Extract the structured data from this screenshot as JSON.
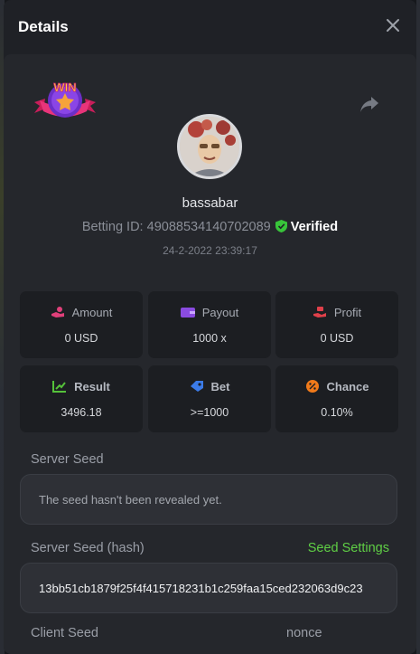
{
  "header": {
    "title": "Details"
  },
  "player": {
    "badge_text": "WIN",
    "username": "bassabar",
    "betting_id_label": "Betting ID:",
    "betting_id": "49088534140702089",
    "verified_label": "Verified",
    "datetime": "24-2-2022 23:39:17"
  },
  "stats": [
    {
      "label": "Amount",
      "value": "0 USD",
      "icon": "hand-coin-icon",
      "color": "#e0407a"
    },
    {
      "label": "Payout",
      "value": "1000 x",
      "icon": "wallet-icon",
      "color": "#8a4be0"
    },
    {
      "label": "Profit",
      "value": "0 USD",
      "icon": "hand-money-icon",
      "color": "#e0404a"
    },
    {
      "label": "Result",
      "value": "3496.18",
      "icon": "chart-check-icon",
      "color": "#55c23a"
    },
    {
      "label": "Bet",
      "value": ">=1000",
      "icon": "tag-icon",
      "color": "#3b7be8"
    },
    {
      "label": "Chance",
      "value": "0.10%",
      "icon": "percent-icon",
      "color": "#f07a1a"
    }
  ],
  "seeds": {
    "server_seed_label": "Server Seed",
    "server_seed_value": "The seed hasn't been revealed yet.",
    "server_hash_label": "Server Seed (hash)",
    "seed_settings_label": "Seed Settings",
    "server_hash_value": "13bb51cb1879f25f4f415718231b1c259faa15ced232063d9c23",
    "client_seed_label": "Client Seed",
    "nonce_label": "nonce"
  },
  "colors": {
    "accent_green": "#5fce45",
    "verified_green": "#38c43a"
  }
}
